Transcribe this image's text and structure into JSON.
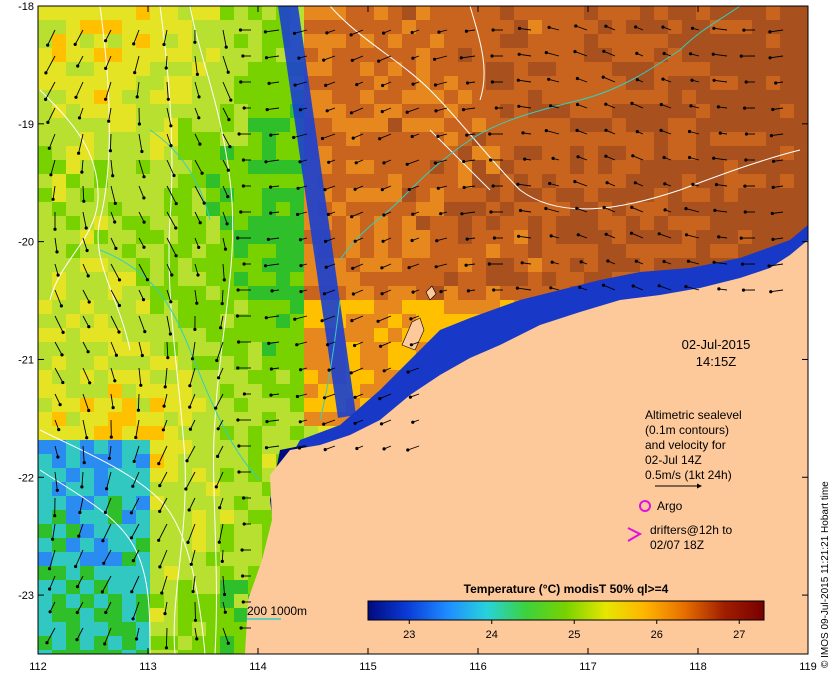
{
  "map": {
    "lon_ticks": [
      "112",
      "113",
      "114",
      "115",
      "116",
      "117",
      "118",
      "119"
    ],
    "lat_ticks": [
      "-18",
      "-19",
      "-20",
      "-21",
      "-22",
      "-23"
    ],
    "lon_range": [
      112,
      119
    ],
    "lat_range": [
      -18,
      -23.5
    ]
  },
  "date": {
    "day": "02-Jul-2015",
    "time": "14:15Z"
  },
  "legend": {
    "altimetry_lines": [
      "Altimetric sealevel",
      "(0.1m contours)",
      "and velocity for",
      "02-Jul 14Z",
      "0.5m/s (1kt 24h)"
    ],
    "argo_label": "Argo",
    "drifters_lines": [
      "drifters@12h to",
      "02/07 18Z"
    ],
    "depth_label": "200  1000m"
  },
  "colorbar": {
    "title": "Temperature (°C) modisT 50% ql>=4",
    "ticks": [
      "23",
      "24",
      "25",
      "26",
      "27"
    ],
    "range": [
      22.5,
      27.3
    ],
    "stops": [
      "#000a80",
      "#0a3cd6",
      "#1e8cff",
      "#28d2dc",
      "#3cd23c",
      "#78d200",
      "#e6e600",
      "#ffb400",
      "#e66e00",
      "#a01e00",
      "#780000"
    ]
  },
  "credit": "© IMOS 09-Jul-2015 11:21:21 Hobart time",
  "colors": {
    "land": "#fdc99b",
    "shelf_blue": "#1838c8",
    "deep_blue": "#000a80",
    "green": "#2fbf2a",
    "yellow": "#e4e424",
    "orange": "#e6881e",
    "brown": "#a8501e",
    "argo": "#e010e0",
    "contour_depth": "#30d0c0"
  }
}
